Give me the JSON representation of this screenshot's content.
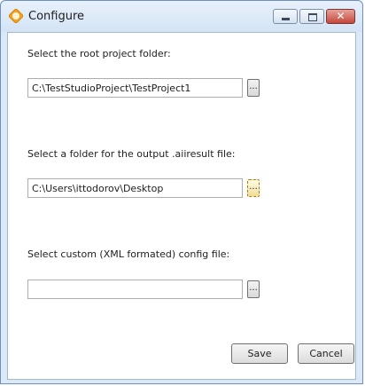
{
  "window": {
    "title": "Configure"
  },
  "root_folder": {
    "label": "Select the root project folder:",
    "value": "C:\\TestStudioProject\\TestProject1",
    "browse_label": "..."
  },
  "output_folder": {
    "label": "Select a folder for the output .aiiresult file:",
    "value": "C:\\Users\\ittodorov\\Desktop",
    "browse_label": "..."
  },
  "config_file": {
    "label": "Select custom (XML formated) config file:",
    "value": "",
    "browse_label": "..."
  },
  "buttons": {
    "save": "Save",
    "cancel": "Cancel"
  },
  "window_buttons": {
    "close": "✕"
  },
  "icons": {
    "app": "telerik-test-studio-icon"
  }
}
